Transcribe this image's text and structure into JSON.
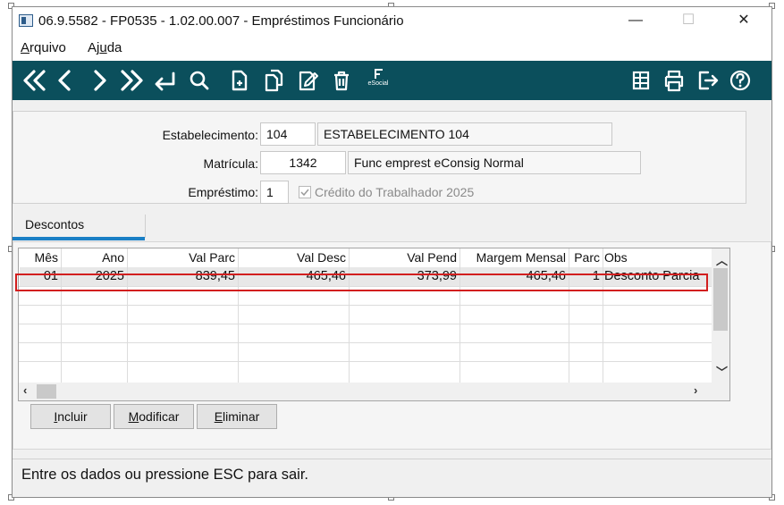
{
  "window": {
    "title": "06.9.5582 - FP0535 - 1.02.00.007 - Empréstimos Funcionário",
    "minimize": "—",
    "maximize": "☐",
    "close": "✕"
  },
  "menu": {
    "arquivo_pre": "",
    "arquivo_ul": "A",
    "arquivo_post": "rquivo",
    "ajuda_pre": "Aj",
    "ajuda_ul": "u",
    "ajuda_post": "da"
  },
  "toolbar": {
    "left_icons": [
      "first-record-icon",
      "previous-record-icon",
      "next-record-icon",
      "last-record-icon",
      "return-icon",
      "search-icon",
      "new-record-icon",
      "copy-record-icon",
      "edit-record-icon",
      "delete-icon",
      "esocial-icon"
    ],
    "right_icons": [
      "layout-icon",
      "print-icon",
      "exit-icon",
      "help-icon"
    ],
    "esocial_label": "eSocial",
    "background": "#0b4f5c"
  },
  "form": {
    "estabelecimento_label": "Estabelecimento:",
    "estabelecimento_code": "104",
    "estabelecimento_name": "ESTABELECIMENTO 104",
    "matricula_label": "Matrícula:",
    "matricula_code": "1342",
    "matricula_name": "Func emprest eConsig Normal",
    "emprestimo_label": "Empréstimo:",
    "emprestimo_value": "1",
    "credito_label": "Crédito do Trabalhador 2025",
    "credito_checked": true
  },
  "tabs": {
    "descontos": "Descontos",
    "accent": "#1a7fc5"
  },
  "grid": {
    "columns": [
      "Mês",
      "Ano",
      "Val Parc",
      "Val Desc",
      "Val Pend",
      "Margem Mensal",
      "Parc",
      "Obs"
    ],
    "rows": [
      {
        "mes": "01",
        "ano": "2025",
        "val_parc": "839,45",
        "val_desc": "465,46",
        "val_pend": "373,99",
        "margem": "465,46",
        "parc": "1",
        "obs": "Desconto Parcia"
      }
    ],
    "highlight_color": "#d21f1f"
  },
  "buttons": {
    "incluir_ul": "I",
    "incluir_post": "ncluir",
    "modificar_ul": "M",
    "modificar_post": "odificar",
    "eliminar_ul": "E",
    "eliminar_post": "liminar"
  },
  "status": {
    "text": "Entre os dados ou pressione ESC para sair."
  }
}
